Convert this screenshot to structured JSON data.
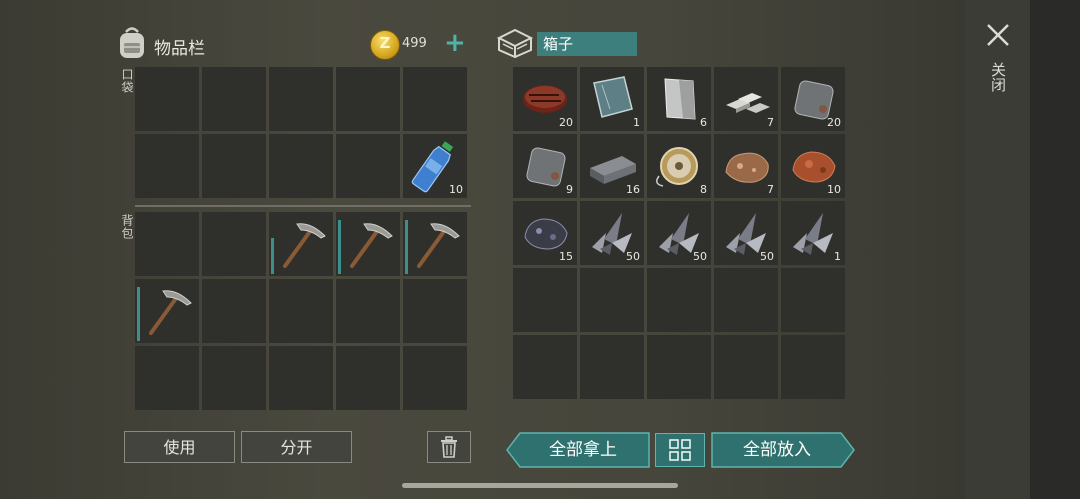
{
  "inventory": {
    "title": "物品栏",
    "coins": "499",
    "coin_symbol": "Z",
    "pocket_label": "口袋",
    "backpack_label": "背包",
    "pocket_slots": [
      {
        "item": "",
        "qty": ""
      },
      {
        "item": "",
        "qty": ""
      },
      {
        "item": "",
        "qty": ""
      },
      {
        "item": "",
        "qty": ""
      },
      {
        "item": "",
        "qty": ""
      },
      {
        "item": "",
        "qty": ""
      },
      {
        "item": "",
        "qty": ""
      },
      {
        "item": "",
        "qty": ""
      },
      {
        "item": "",
        "qty": ""
      },
      {
        "item": "water-bottle-icon",
        "qty": "10"
      }
    ],
    "backpack_slots": [
      {
        "item": "",
        "qty": ""
      },
      {
        "item": "",
        "qty": ""
      },
      {
        "item": "pickaxe-icon",
        "qty": "",
        "durability": 0.6
      },
      {
        "item": "pickaxe-icon",
        "qty": "",
        "durability": 0.9
      },
      {
        "item": "pickaxe-icon",
        "qty": "",
        "durability": 0.9
      },
      {
        "item": "pickaxe-icon",
        "qty": "",
        "durability": 0.9
      },
      {
        "item": "",
        "qty": ""
      },
      {
        "item": "",
        "qty": ""
      },
      {
        "item": "",
        "qty": ""
      },
      {
        "item": "",
        "qty": ""
      },
      {
        "item": "",
        "qty": ""
      },
      {
        "item": "",
        "qty": ""
      },
      {
        "item": "",
        "qty": ""
      },
      {
        "item": "",
        "qty": ""
      },
      {
        "item": "",
        "qty": ""
      }
    ],
    "use_label": "使用",
    "split_label": "分开"
  },
  "box": {
    "name": "箱子",
    "slots": [
      {
        "item": "meat-icon",
        "qty": "20"
      },
      {
        "item": "glass-pane-icon",
        "qty": "1"
      },
      {
        "item": "metal-sheet-icon",
        "qty": "6"
      },
      {
        "item": "ingots-icon",
        "qty": "7"
      },
      {
        "item": "iron-plate-icon",
        "qty": "20"
      },
      {
        "item": "iron-plate-icon",
        "qty": "9"
      },
      {
        "item": "metal-bar-icon",
        "qty": "16"
      },
      {
        "item": "wire-spool-icon",
        "qty": "8"
      },
      {
        "item": "copper-ore-icon",
        "qty": "7"
      },
      {
        "item": "copper-ore-red-icon",
        "qty": "10"
      },
      {
        "item": "coal-ore-icon",
        "qty": "15"
      },
      {
        "item": "scrap-metal-icon",
        "qty": "50"
      },
      {
        "item": "scrap-metal-icon",
        "qty": "50"
      },
      {
        "item": "scrap-metal-icon",
        "qty": "50"
      },
      {
        "item": "scrap-metal-icon",
        "qty": "1"
      },
      {
        "item": "",
        "qty": ""
      },
      {
        "item": "",
        "qty": ""
      },
      {
        "item": "",
        "qty": ""
      },
      {
        "item": "",
        "qty": ""
      },
      {
        "item": "",
        "qty": ""
      },
      {
        "item": "",
        "qty": ""
      },
      {
        "item": "",
        "qty": ""
      },
      {
        "item": "",
        "qty": ""
      },
      {
        "item": "",
        "qty": ""
      },
      {
        "item": "",
        "qty": ""
      }
    ],
    "take_all_label": "全部拿上",
    "put_all_label": "全部放入",
    "sort_icon": "grid-sort-icon"
  },
  "close_label": "关闭",
  "colors": {
    "accent": "#3c8f8a",
    "slot": "#2f302c",
    "button_teal": "#2e6f6c"
  }
}
